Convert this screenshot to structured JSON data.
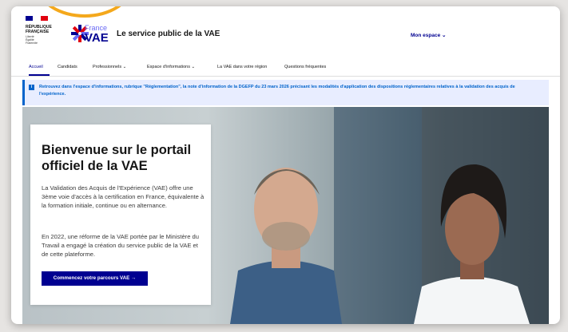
{
  "header": {
    "republic_text": "RÉPUBLIQUE\nFRANÇAISE",
    "motto_text": "Liberté\nÉgalité\nFraternité",
    "logo_france": "France",
    "logo_vae": "VAE",
    "site_title": "Le service public de la VAE",
    "account_label": "Mon espace ⌄"
  },
  "nav": {
    "items": [
      {
        "label": "Accueil",
        "active": true
      },
      {
        "label": "Candidats"
      },
      {
        "label": "Professionnels ⌄"
      },
      {
        "label": "Espace d'informations ⌄"
      },
      {
        "label": "La VAE dans votre région"
      },
      {
        "label": "Questions fréquentes"
      }
    ]
  },
  "notice": {
    "icon": "i",
    "text": "Retrouvez dans l'espace d'informations, rubrique \"Réglementation\", la note d'information de la DGEFP du 23 mars 2026 précisant les modalités d'application des dispositions réglementaires relatives à la validation des acquis de l'expérience."
  },
  "hero": {
    "title": "Bienvenue sur le portail officiel de la VAE",
    "paragraph1": "La Validation des Acquis de l'Expérience (VAE) offre une 3ème voie d'accès à la certification en France, équivalente à la formation initiale, continue ou en alternance.",
    "paragraph2": "En 2022, une réforme de la VAE portée par le Ministère du Travail a engagé la création du service public de la VAE et de cette plateforme.",
    "cta_label": "Commencez votre parcours VAE →"
  },
  "colors": {
    "primary": "#000091",
    "info": "#0063cb",
    "info_bg": "#e8edff",
    "badge": "#f4a81c"
  }
}
